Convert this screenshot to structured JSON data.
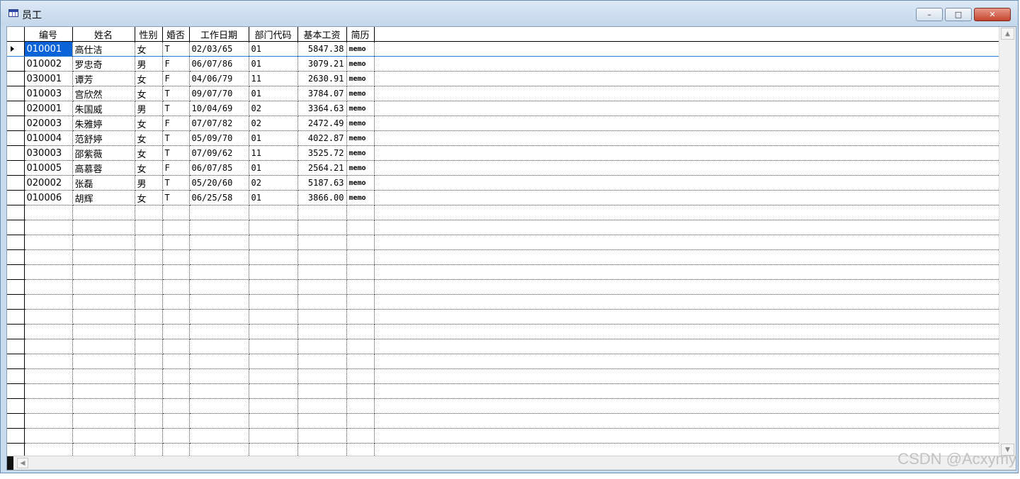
{
  "window": {
    "title": "员工",
    "buttons": {
      "minimize": "–",
      "maximize": "□",
      "close": "✕"
    }
  },
  "grid": {
    "columns": [
      "编号",
      "姓名",
      "性别",
      "婚否",
      "工作日期",
      "部门代码",
      "基本工资",
      "简历"
    ],
    "rows": [
      [
        "010001",
        "高仕洁",
        "女",
        "T",
        "02/03/65",
        "01",
        "5847.38",
        "memo"
      ],
      [
        "010002",
        "罗忠奇",
        "男",
        "F",
        "06/07/86",
        "01",
        "3079.21",
        "memo"
      ],
      [
        "030001",
        "谭芳",
        "女",
        "F",
        "04/06/79",
        "11",
        "2630.91",
        "memo"
      ],
      [
        "010003",
        " 宫欣然",
        "女",
        "T",
        "09/07/70",
        "01",
        "3784.07",
        "memo"
      ],
      [
        "020001",
        "朱国威",
        "男",
        "T",
        "10/04/69",
        "02",
        "3364.63",
        "memo"
      ],
      [
        "020003",
        "朱雅婷",
        "女",
        "F",
        "07/07/82",
        "02",
        "2472.49",
        "memo"
      ],
      [
        "010004",
        "范舒婷",
        "女",
        "T",
        "05/09/70",
        "01",
        "4022.87",
        "memo"
      ],
      [
        "030003",
        "邵紫薇",
        "女",
        "T",
        "07/09/62",
        "11",
        "3525.72",
        "memo"
      ],
      [
        "010005",
        "高慕蓉",
        "女",
        "F",
        "06/07/85",
        "01",
        "2564.21",
        "memo"
      ],
      [
        "020002",
        "张磊",
        "男",
        "T",
        "05/20/60",
        "02",
        "5187.63",
        "memo"
      ],
      [
        "010006",
        "胡辉",
        "女",
        "T",
        "06/25/58",
        "01",
        "3866.00",
        "memo"
      ]
    ],
    "current_row": 0
  },
  "watermark": "CSDN @Acxymy"
}
